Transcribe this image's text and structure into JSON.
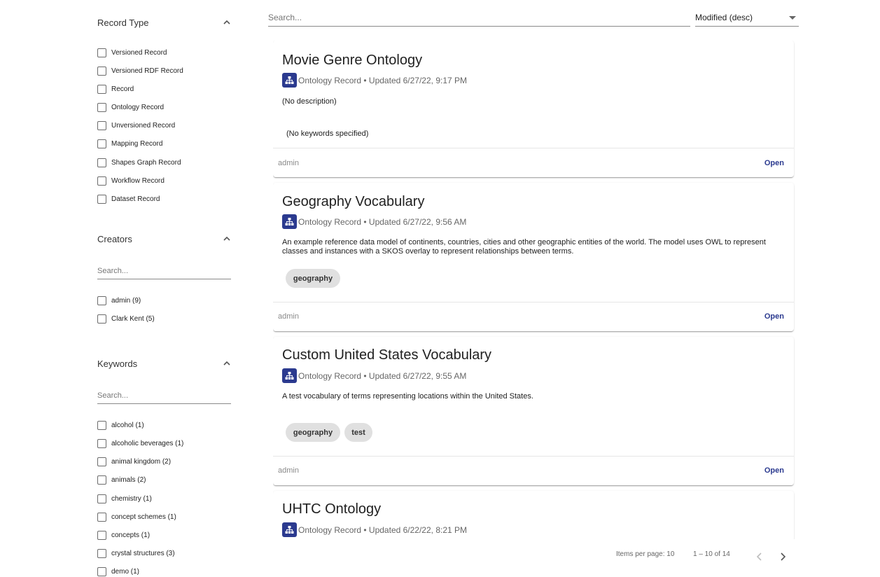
{
  "sidebar": {
    "record_type": {
      "title": "Record Type",
      "options": [
        "Versioned Record",
        "Versioned RDF Record",
        "Record",
        "Ontology Record",
        "Unversioned Record",
        "Mapping Record",
        "Shapes Graph Record",
        "Workflow Record",
        "Dataset Record"
      ]
    },
    "creators": {
      "title": "Creators",
      "search_placeholder": "Search...",
      "options": [
        "admin (9)",
        "Clark Kent (5)"
      ]
    },
    "keywords": {
      "title": "Keywords",
      "search_placeholder": "Search...",
      "options": [
        "alcohol (1)",
        "alcoholic beverages (1)",
        "animal kingdom (2)",
        "animals (2)",
        "chemistry (1)",
        "concept schemes (1)",
        "concepts (1)",
        "crystal structures (3)",
        "demo (1)"
      ]
    }
  },
  "toolbar": {
    "search_placeholder": "Search...",
    "sort_value": "Modified (desc)"
  },
  "records": [
    {
      "title": "Movie Genre Ontology",
      "meta": "Ontology Record • Updated 6/27/22, 9:17 PM",
      "description": "(No description)",
      "no_keywords": "(No keywords specified)",
      "keywords": [],
      "owner": "admin",
      "open_label": "Open"
    },
    {
      "title": "Geography Vocabulary",
      "meta": "Ontology Record • Updated 6/27/22, 9:56 AM",
      "description": "An example reference data model of continents, countries, cities and other geographic entities of the world. The model uses OWL to represent classes and instances with a SKOS overlay to represent relationships between terms.",
      "keywords": [
        "geography"
      ],
      "owner": "admin",
      "open_label": "Open"
    },
    {
      "title": "Custom United States Vocabulary",
      "meta": "Ontology Record • Updated 6/27/22, 9:55 AM",
      "description": "A test vocabulary of terms representing locations within the United States.",
      "keywords": [
        "geography",
        "test"
      ],
      "owner": "admin",
      "open_label": "Open"
    },
    {
      "title": "UHTC Ontology",
      "meta": "Ontology Record • Updated 6/22/22, 8:21 PM"
    }
  ],
  "paginator": {
    "items_per_page": "Items per page: 10",
    "range": "1 – 10 of 14"
  },
  "colors": {
    "accent": "#2b3a8f",
    "chip_bg": "#e0e0e0"
  }
}
